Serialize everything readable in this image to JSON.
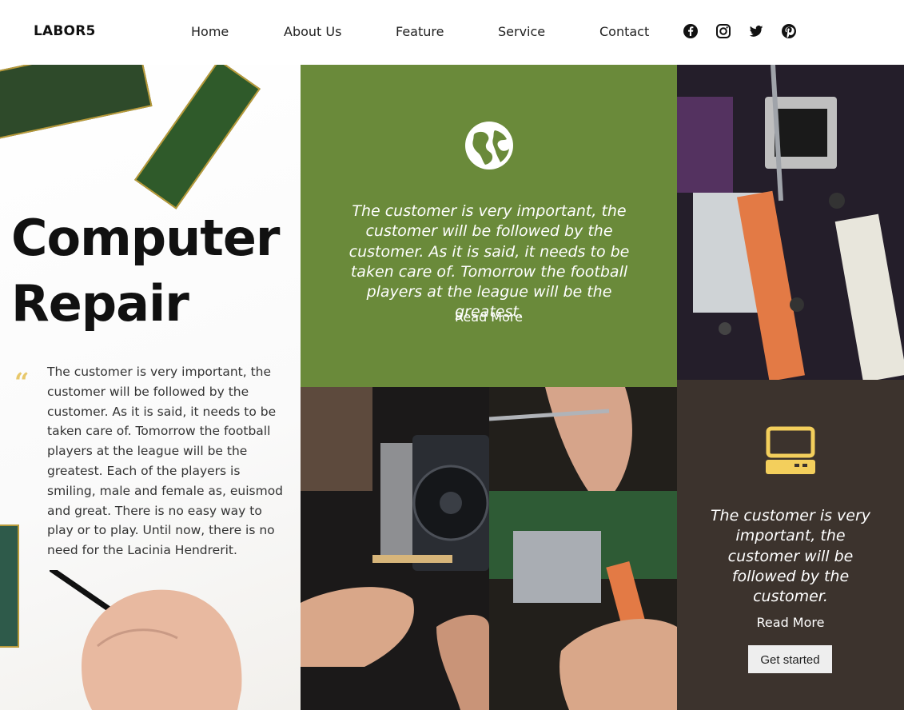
{
  "brand": "LABOR5",
  "nav": [
    "Home",
    "About Us",
    "Feature",
    "Service",
    "Contact"
  ],
  "social_icons": [
    "facebook-icon",
    "instagram-icon",
    "twitter-icon",
    "pinterest-icon"
  ],
  "hero": {
    "title_line1": "Computer",
    "title_line2": "Repair",
    "quote_mark": "“",
    "text": "The customer is very important, the customer will be followed by the customer. As it is said, it needs to be taken care of. Tomorrow the football players at the league will be the greatest. Each of the players is smiling, male and female as, euismod and great. There is no easy way to play or to play. Until now, there is no need for the Lacinia Hendrerit."
  },
  "feature_green": {
    "icon": "globe-icon",
    "text": "The customer is very important, the customer will be followed by the customer. As it is said, it needs to be taken care of. Tomorrow the football players at the league will be the greatest.",
    "link": "Read More"
  },
  "feature_dark": {
    "icon": "computer-icon",
    "text": "The customer is very important, the customer will be followed by the customer.",
    "link": "Read More",
    "button": "Get started"
  },
  "colors": {
    "green": "#6a8a3a",
    "dark": "#3c332d",
    "accent": "#f3cf5c"
  }
}
